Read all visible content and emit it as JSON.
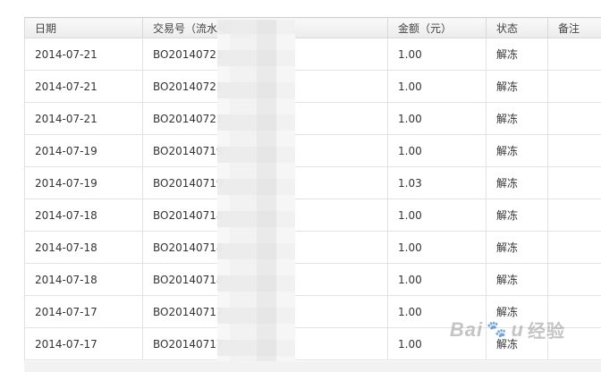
{
  "table": {
    "headers": [
      "日期",
      "交易号（流水号）",
      "金额（元）",
      "状态",
      "备注"
    ],
    "rows": [
      {
        "date": "2014-07-21",
        "txn": "BO20140721",
        "amount": "1.00",
        "status": "解冻",
        "note": ""
      },
      {
        "date": "2014-07-21",
        "txn": "BO20140721",
        "amount": "1.00",
        "status": "解冻",
        "note": ""
      },
      {
        "date": "2014-07-21",
        "txn": "BO20140721",
        "amount": "1.00",
        "status": "解冻",
        "note": ""
      },
      {
        "date": "2014-07-19",
        "txn": "BO20140719",
        "amount": "1.00",
        "status": "解冻",
        "note": ""
      },
      {
        "date": "2014-07-19",
        "txn": "BO20140719",
        "amount": "1.03",
        "status": "解冻",
        "note": ""
      },
      {
        "date": "2014-07-18",
        "txn": "BO20140718",
        "amount": "1.00",
        "status": "解冻",
        "note": ""
      },
      {
        "date": "2014-07-18",
        "txn": "BO20140718",
        "amount": "1.00",
        "status": "解冻",
        "note": ""
      },
      {
        "date": "2014-07-18",
        "txn": "BO20140718",
        "amount": "1.00",
        "status": "解冻",
        "note": ""
      },
      {
        "date": "2014-07-17",
        "txn": "BO20140717",
        "amount": "1.00",
        "status": "解冻",
        "note": ""
      },
      {
        "date": "2014-07-17",
        "txn": "BO20140717",
        "amount": "1.00",
        "status": "解冻",
        "note": ""
      }
    ]
  },
  "watermark": {
    "brand": "Bai",
    "paw": "🐾",
    "tail": "u",
    "jingyan": "经验"
  }
}
